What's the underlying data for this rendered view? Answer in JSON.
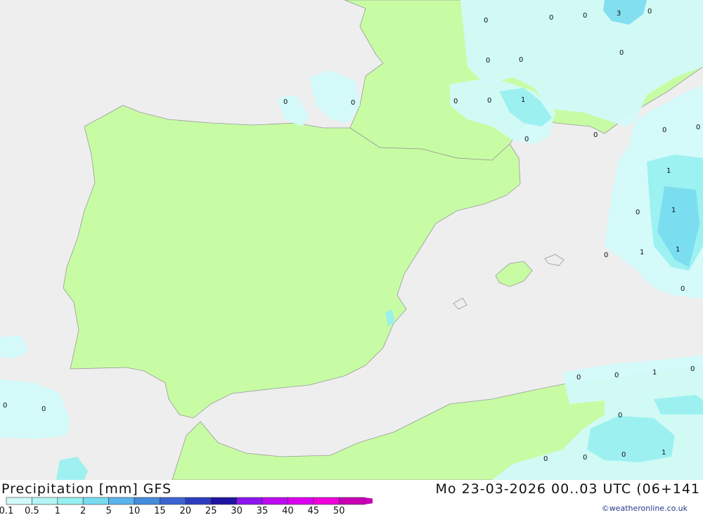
{
  "footer": {
    "title": "Precipitation [mm] GFS",
    "timestamp": "Mo 23-03-2026 00..03 UTC (06+141",
    "credit": "©weatheronline.co.uk"
  },
  "legend": {
    "labels": [
      "0.1",
      "0.5",
      "1",
      "2",
      "5",
      "10",
      "15",
      "20",
      "25",
      "30",
      "35",
      "40",
      "45",
      "50"
    ],
    "colors": [
      "#d2fafa",
      "#b4f5f5",
      "#96f0f0",
      "#78dcf0",
      "#5ab4ee",
      "#468cdc",
      "#3c64d2",
      "#2d3cbe",
      "#1e14a0",
      "#8c14f0",
      "#be0af0",
      "#dc00f0",
      "#f000dc",
      "#c800b4"
    ]
  },
  "map": {
    "land_color": "#c8fca4",
    "sea_color": "#eeeeee",
    "value_labels": [
      "3",
      "1",
      "0"
    ]
  }
}
